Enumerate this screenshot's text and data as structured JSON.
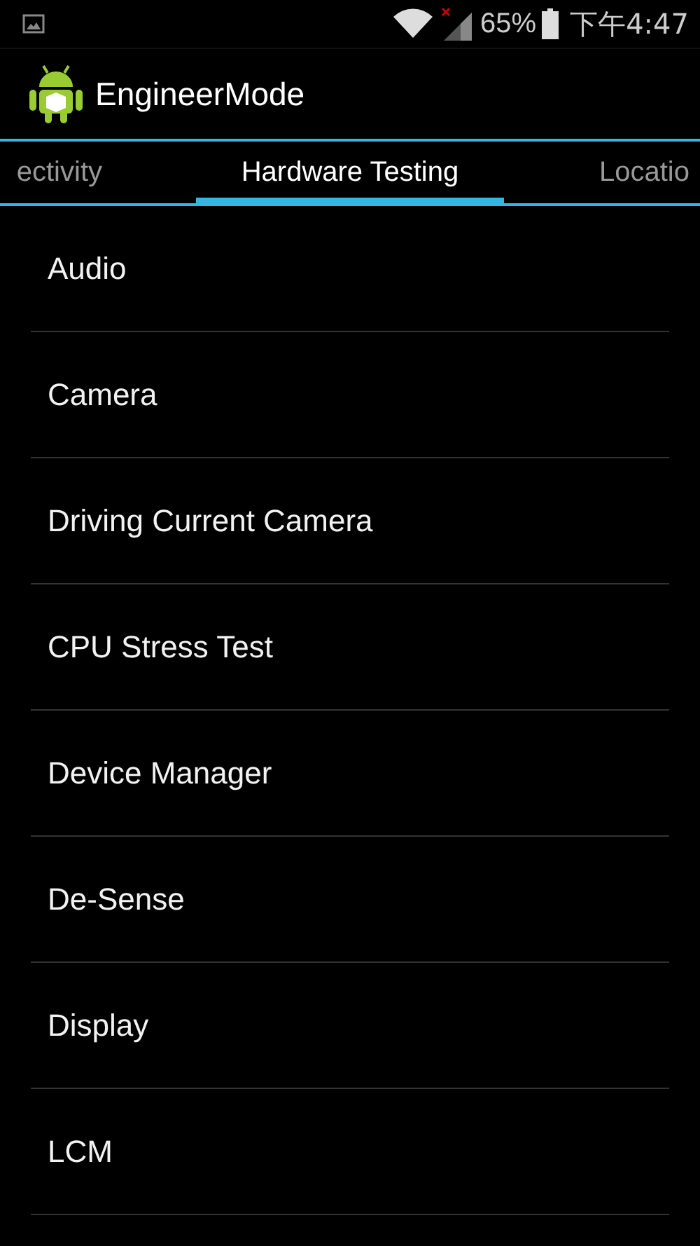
{
  "status_bar": {
    "battery_percent": "65%",
    "time": "下午4:47"
  },
  "action_bar": {
    "title": "EngineerMode"
  },
  "tabs": [
    {
      "label": "ectivity",
      "selected": false
    },
    {
      "label": "Hardware Testing",
      "selected": true
    },
    {
      "label": "Locatio",
      "selected": false
    }
  ],
  "items": [
    {
      "label": "Audio"
    },
    {
      "label": "Camera"
    },
    {
      "label": "Driving Current Camera"
    },
    {
      "label": "CPU Stress Test"
    },
    {
      "label": "Device Manager"
    },
    {
      "label": "De-Sense"
    },
    {
      "label": "Display"
    },
    {
      "label": "LCM"
    }
  ]
}
